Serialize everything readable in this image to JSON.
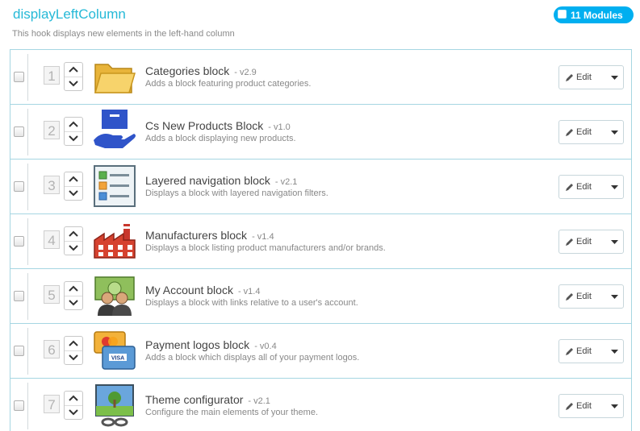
{
  "hook": {
    "title": "displayLeftColumn",
    "description": "This hook displays new elements in the left-hand column",
    "module_count": "11 Modules"
  },
  "edit_label": "Edit",
  "modules": [
    {
      "position": "1",
      "name": "Categories block",
      "version": "- v2.9",
      "description": "Adds a block featuring product categories.",
      "icon": "folder-icon"
    },
    {
      "position": "2",
      "name": "Cs New Products Block",
      "version": "- v1.0",
      "description": "Adds a block displaying new products.",
      "icon": "new-products-icon"
    },
    {
      "position": "3",
      "name": "Layered navigation block",
      "version": "- v2.1",
      "description": "Displays a block with layered navigation filters.",
      "icon": "filter-list-icon"
    },
    {
      "position": "4",
      "name": "Manufacturers block",
      "version": "- v1.4",
      "description": "Displays a block listing product manufacturers and/or brands.",
      "icon": "factory-icon"
    },
    {
      "position": "5",
      "name": "My Account block",
      "version": "- v1.4",
      "description": "Displays a block with links relative to a user's account.",
      "icon": "account-users-icon"
    },
    {
      "position": "6",
      "name": "Payment logos block",
      "version": "- v0.4",
      "description": "Adds a block which displays all of your payment logos.",
      "icon": "payment-cards-icon"
    },
    {
      "position": "7",
      "name": "Theme configurator",
      "version": "- v2.1",
      "description": "Configure the main elements of your theme.",
      "icon": "theme-image-icon"
    }
  ]
}
